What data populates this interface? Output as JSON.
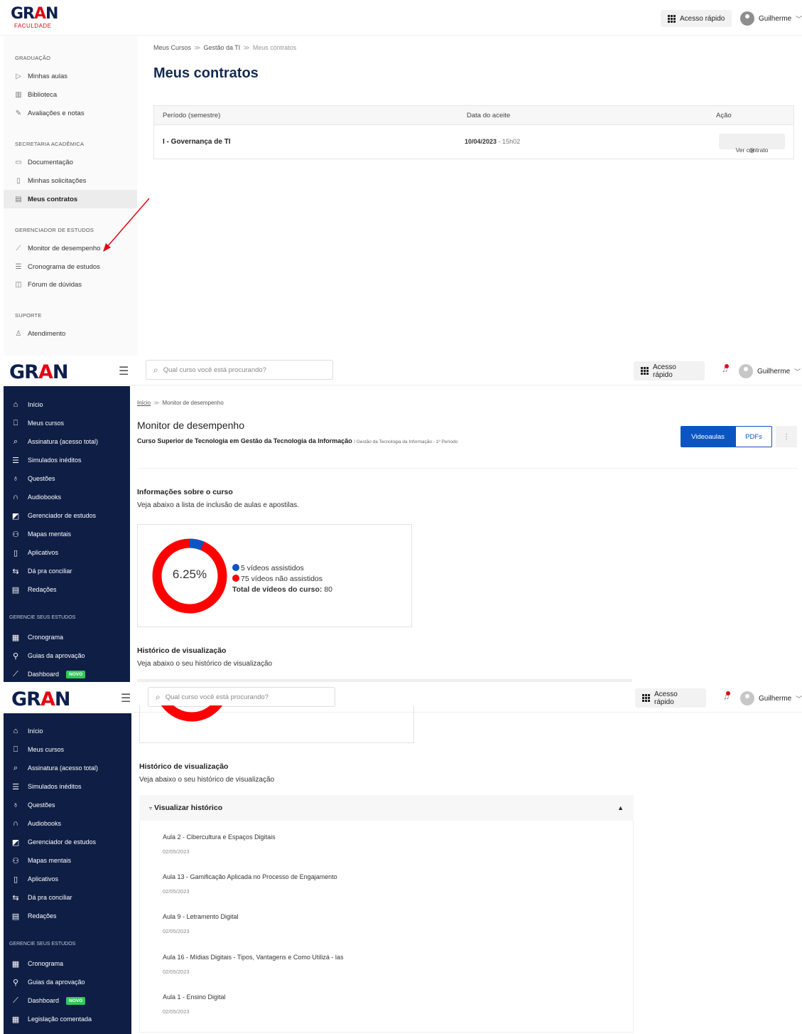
{
  "p1": {
    "logo": {
      "word": "GRAN",
      "sub": "FACULDADE"
    },
    "quick_access": "Acesso rápido",
    "user": "Guilherme",
    "sidebar": [
      {
        "section": "GRADUAÇÃO",
        "items": [
          {
            "label": "Minhas aulas",
            "icon": "play-icon"
          },
          {
            "label": "Biblioteca",
            "icon": "library-icon"
          },
          {
            "label": "Avaliações e notas",
            "icon": "pencil-icon"
          }
        ]
      },
      {
        "section": "SECRETARIA ACADÊMICA",
        "items": [
          {
            "label": "Documentação",
            "icon": "folder-icon"
          },
          {
            "label": "Minhas solicitações",
            "icon": "clipboard-icon"
          },
          {
            "label": "Meus contratos",
            "icon": "document-icon"
          }
        ]
      },
      {
        "section": "GERENCIADOR DE ESTUDOS",
        "items": [
          {
            "label": "Monitor de desempenho",
            "icon": "chart-line-icon"
          },
          {
            "label": "Cronograma de estudos",
            "icon": "sliders-icon"
          },
          {
            "label": "Fórum de dúvidas",
            "icon": "chat-icon"
          }
        ]
      },
      {
        "section": "SUPORTE",
        "items": [
          {
            "label": "Atendimento",
            "icon": "support-icon"
          }
        ]
      }
    ],
    "breadcrumb": [
      "Meus Cursos",
      "Gestão da TI",
      "Meus contratos"
    ],
    "title": "Meus contratos",
    "table": {
      "headers": [
        "Período (semestre)",
        "Data do aceite",
        "Ação"
      ],
      "rows": [
        {
          "period": "I - Governança de TI",
          "date": "10/04/2023",
          "time": "- 15h02",
          "action": "Ver contrato"
        }
      ]
    },
    "arrow_color": "#e30613"
  },
  "p2": {
    "logo": "GRAN",
    "search_placeholder": "Qual curso você está procurando?",
    "quick_access": "Acesso rápido",
    "user": "Guilherme",
    "nav": [
      "Início",
      "Meus cursos",
      "Assinatura (acesso total)",
      "Simulados inéditos",
      "Questões",
      "Audiobooks",
      "Gerenciador de estudos",
      "Mapas mentais",
      "Aplicativos",
      "Dá pra conciliar",
      "Redações"
    ],
    "nav_section": "GERENCIE SEUS ESTUDOS",
    "nav2": [
      "Cronograma",
      "Guias da aprovação",
      "Dashboard"
    ],
    "badge_new": "NOVO",
    "breadcrumb": [
      "Início",
      "Monitor de desempenho"
    ],
    "title": "Monitor de desempenho",
    "course": "Curso Superior de Tecnologia em Gestão da Tecnologia da Informação",
    "course_detail": "/ Gestão da Tecnologia da Informação - 1º Período",
    "tabs": [
      "Videoaulas",
      "PDFs"
    ],
    "kebab": "⋮",
    "info_title": "Informações sobre o curso",
    "info_desc": "Veja abaixo a lista de inclusão de aulas e apostilas.",
    "donut": {
      "percent_label": "6.25%",
      "watched": 5,
      "watched_label": "vídeos assistidos",
      "not_watched": 75,
      "not_watched_label": "vídeos não assistidos",
      "total_label": "Total de vídeos do curso:",
      "total": "80",
      "colors": {
        "watched": "#0a55c2",
        "not_watched": "#ff0000"
      }
    },
    "hist_title": "Histórico de visualização",
    "hist_desc": "Veja abaixo o seu histórico de visualização"
  },
  "p3": {
    "logo": "GRAN",
    "search_placeholder": "Qual curso você está procurando?",
    "quick_access": "Acesso rápido",
    "user": "Guilherme",
    "nav": [
      "Início",
      "Meus cursos",
      "Assinatura (acesso total)",
      "Simulados inéditos",
      "Questões",
      "Audiobooks",
      "Gerenciador de estudos",
      "Mapas mentais",
      "Aplicativos",
      "Dá pra conciliar",
      "Redações"
    ],
    "nav_section": "GERENCIE SEUS ESTUDOS",
    "nav2": [
      "Cronograma",
      "Guias da aprovação",
      "Dashboard",
      "Legislação comentada"
    ],
    "badge_new": "NOVO",
    "hist_title": "Histórico de visualização",
    "hist_desc": "Veja abaixo o seu histórico de visualização",
    "accordion": "Visualizar histórico",
    "history": [
      {
        "title": "Aula 2 - Cibercultura e Espaços Digitais",
        "date": "02/05/2023"
      },
      {
        "title": "Aula 13 - Gamificação Aplicada no Processo de Engajamento",
        "date": "02/05/2023"
      },
      {
        "title": "Aula 9 - Letramento Digital",
        "date": "02/05/2023"
      },
      {
        "title": "Aula 16 - Mídias Digitais - Tipos, Vantagens e Como Utilizá - las",
        "date": "02/05/2023"
      },
      {
        "title": "Aula 1 - Ensino Digital",
        "date": "02/05/2023"
      }
    ]
  }
}
